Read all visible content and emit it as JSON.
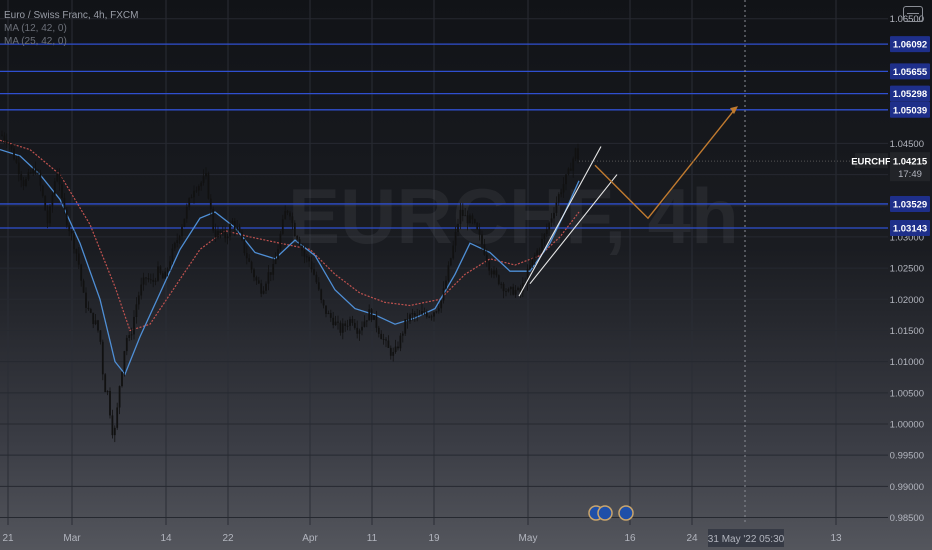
{
  "legend": {
    "symbol_line": "Euro / Swiss Franc, 4h, FXCM",
    "ma1": "MA (12, 42, 0)",
    "ma2": "MA (25, 42, 0)"
  },
  "colors": {
    "level_line": "#2f4fd0",
    "price_label_bg": "#1e2f8a",
    "candle": "#111111",
    "ma_fast": "#4f8fd6",
    "ma_slow": "#c0524f",
    "projection": "#c07a2f",
    "trendline": "#e8e8e8",
    "symbol_label_bg": "#222428"
  },
  "chart_data": {
    "type": "candlestick",
    "symbol": "EURCHF",
    "watermark": "EURCHF, 4h",
    "ylim": [
      0.9838,
      1.068
    ],
    "y_ticks": [
      "0.98500",
      "0.99000",
      "0.99500",
      "1.00000",
      "1.00500",
      "1.01000",
      "1.01500",
      "1.02000",
      "1.02500",
      "1.03000",
      "1.03500",
      "1.04000",
      "1.04500",
      "1.06500"
    ],
    "x_ticks": [
      "21",
      "Mar",
      "14",
      "22",
      "Apr",
      "11",
      "19",
      "May",
      "16",
      "24",
      "13"
    ],
    "crosshair_label": "31 May '22   05:30",
    "current_price": "1.04215",
    "countdown": "17:49",
    "levels": [
      {
        "price": 1.06092,
        "label": "1.06092"
      },
      {
        "price": 1.05655,
        "label": "1.05655"
      },
      {
        "price": 1.05298,
        "label": "1.05298"
      },
      {
        "price": 1.05039,
        "label": "1.05039"
      },
      {
        "price": 1.03529,
        "label": "1.03529"
      },
      {
        "price": 1.03143,
        "label": "1.03143"
      }
    ],
    "price_path": [
      [
        0,
        1.0465
      ],
      [
        8,
        1.0455
      ],
      [
        16,
        1.042
      ],
      [
        24,
        1.0385
      ],
      [
        30,
        1.04
      ],
      [
        36,
        1.041
      ],
      [
        42,
        1.037
      ],
      [
        48,
        1.032
      ],
      [
        54,
        1.0385
      ],
      [
        58,
        1.041
      ],
      [
        62,
        1.0355
      ],
      [
        66,
        1.033
      ],
      [
        72,
        1.03
      ],
      [
        78,
        1.0265
      ],
      [
        84,
        1.02
      ],
      [
        90,
        1.0175
      ],
      [
        96,
        1.016
      ],
      [
        100,
        1.014
      ],
      [
        104,
        1.006
      ],
      [
        108,
        1.005
      ],
      [
        112,
        0.999
      ],
      [
        116,
        0.999
      ],
      [
        118,
        1.0045
      ],
      [
        122,
        1.009
      ],
      [
        126,
        1.014
      ],
      [
        130,
        1.0135
      ],
      [
        136,
        1.019
      ],
      [
        140,
        1.0215
      ],
      [
        146,
        1.0235
      ],
      [
        152,
        1.0225
      ],
      [
        158,
        1.0245
      ],
      [
        164,
        1.023
      ],
      [
        170,
        1.0265
      ],
      [
        176,
        1.029
      ],
      [
        182,
        1.032
      ],
      [
        188,
        1.035
      ],
      [
        194,
        1.038
      ],
      [
        200,
        1.0385
      ],
      [
        206,
        1.0395
      ],
      [
        210,
        1.035
      ],
      [
        214,
        1.0305
      ],
      [
        220,
        1.0305
      ],
      [
        226,
        1.03
      ],
      [
        232,
        1.0325
      ],
      [
        238,
        1.031
      ],
      [
        244,
        1.028
      ],
      [
        250,
        1.0255
      ],
      [
        256,
        1.023
      ],
      [
        262,
        1.0215
      ],
      [
        268,
        1.024
      ],
      [
        274,
        1.025
      ],
      [
        280,
        1.03
      ],
      [
        286,
        1.0345
      ],
      [
        290,
        1.034
      ],
      [
        294,
        1.031
      ],
      [
        298,
        1.03
      ],
      [
        304,
        1.027
      ],
      [
        310,
        1.026
      ],
      [
        316,
        1.023
      ],
      [
        322,
        1.019
      ],
      [
        328,
        1.0175
      ],
      [
        334,
        1.0165
      ],
      [
        340,
        1.015
      ],
      [
        346,
        1.016
      ],
      [
        352,
        1.017
      ],
      [
        358,
        1.015
      ],
      [
        364,
        1.0165
      ],
      [
        370,
        1.018
      ],
      [
        376,
        1.016
      ],
      [
        382,
        1.014
      ],
      [
        388,
        1.012
      ],
      [
        394,
        1.011
      ],
      [
        400,
        1.0135
      ],
      [
        406,
        1.0165
      ],
      [
        412,
        1.0175
      ],
      [
        418,
        1.017
      ],
      [
        424,
        1.018
      ],
      [
        430,
        1.0175
      ],
      [
        436,
        1.0185
      ],
      [
        442,
        1.02
      ],
      [
        448,
        1.0245
      ],
      [
        454,
        1.029
      ],
      [
        460,
        1.034
      ],
      [
        466,
        1.033
      ],
      [
        472,
        1.0325
      ],
      [
        478,
        1.0305
      ],
      [
        484,
        1.028
      ],
      [
        490,
        1.025
      ],
      [
        496,
        1.0235
      ],
      [
        502,
        1.0225
      ],
      [
        508,
        1.021
      ],
      [
        514,
        1.0215
      ],
      [
        520,
        1.021
      ],
      [
        526,
        1.0235
      ],
      [
        532,
        1.026
      ],
      [
        538,
        1.028
      ],
      [
        544,
        1.03
      ],
      [
        550,
        1.0325
      ],
      [
        556,
        1.0355
      ],
      [
        562,
        1.038
      ],
      [
        568,
        1.04
      ],
      [
        572,
        1.042
      ],
      [
        576,
        1.044
      ],
      [
        579,
        1.04215
      ]
    ],
    "ma_fast_path": [
      [
        0,
        1.044
      ],
      [
        20,
        1.043
      ],
      [
        40,
        1.04
      ],
      [
        60,
        1.036
      ],
      [
        80,
        1.029
      ],
      [
        100,
        1.02
      ],
      [
        115,
        1.01
      ],
      [
        125,
        1.008
      ],
      [
        140,
        1.014
      ],
      [
        160,
        1.021
      ],
      [
        180,
        1.028
      ],
      [
        200,
        1.033
      ],
      [
        215,
        1.034
      ],
      [
        235,
        1.0315
      ],
      [
        255,
        1.0275
      ],
      [
        275,
        1.0265
      ],
      [
        295,
        1.0295
      ],
      [
        315,
        1.027
      ],
      [
        335,
        1.0215
      ],
      [
        355,
        1.0185
      ],
      [
        375,
        1.0175
      ],
      [
        395,
        1.016
      ],
      [
        415,
        1.017
      ],
      [
        435,
        1.0185
      ],
      [
        455,
        1.024
      ],
      [
        470,
        1.029
      ],
      [
        490,
        1.0275
      ],
      [
        510,
        1.0245
      ],
      [
        530,
        1.0245
      ],
      [
        550,
        1.029
      ],
      [
        565,
        1.034
      ],
      [
        579,
        1.039
      ]
    ],
    "ma_slow_path": [
      [
        0,
        1.0455
      ],
      [
        30,
        1.044
      ],
      [
        60,
        1.04
      ],
      [
        90,
        1.032
      ],
      [
        115,
        1.022
      ],
      [
        130,
        1.015
      ],
      [
        150,
        1.016
      ],
      [
        175,
        1.022
      ],
      [
        200,
        1.028
      ],
      [
        225,
        1.031
      ],
      [
        250,
        1.03
      ],
      [
        280,
        1.029
      ],
      [
        310,
        1.028
      ],
      [
        335,
        1.024
      ],
      [
        360,
        1.021
      ],
      [
        385,
        1.0195
      ],
      [
        410,
        1.019
      ],
      [
        440,
        1.02
      ],
      [
        465,
        1.024
      ],
      [
        490,
        1.0265
      ],
      [
        515,
        1.0255
      ],
      [
        540,
        1.027
      ],
      [
        560,
        1.03
      ],
      [
        579,
        1.034
      ]
    ],
    "projection_path": [
      [
        595,
        1.0415
      ],
      [
        648,
        1.033
      ],
      [
        735,
        1.0505
      ]
    ],
    "trendlines": [
      [
        [
          519,
          1.0205
        ],
        [
          601,
          1.0445
        ]
      ],
      [
        [
          530,
          1.0225
        ],
        [
          617,
          1.04
        ]
      ]
    ]
  }
}
